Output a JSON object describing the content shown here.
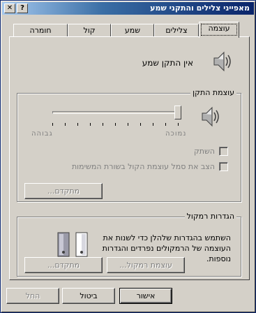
{
  "window": {
    "title": "מאפייני צלילים והתקני שמע",
    "help_button": "?",
    "close_button": "✕"
  },
  "tabs": [
    {
      "label": "עוצמה",
      "active": true
    },
    {
      "label": "צלילים",
      "active": false
    },
    {
      "label": "שמע",
      "active": false
    },
    {
      "label": "קול",
      "active": false
    },
    {
      "label": "חומרה",
      "active": false
    }
  ],
  "device": {
    "label": "אין התקן שמע",
    "icon": "speaker-icon"
  },
  "device_volume": {
    "group_label": "עוצמת התקן",
    "low_label": "נמוכה",
    "high_label": "גבוהה",
    "level": 0.0,
    "mute_label": "השתק",
    "tray_label": "הצב את סמל עוצמת הקול בשורת המשימות",
    "advanced_button": "מתקדם..."
  },
  "speaker_settings": {
    "group_label": "הגדרות רמקול",
    "description": "השתמש בהגדרות שלהלן כדי לשנות את העוצמה של הרמקולים נפרדים והגדרות נוספות.",
    "speaker_volume_button": "עוצמת רמקול...",
    "advanced_button": "מתקדם..."
  },
  "footer": {
    "ok_button": "אישור",
    "cancel_button": "ביטול",
    "apply_button": "החל"
  },
  "colors": {
    "titlebar_dark": "#0a246a",
    "titlebar_light": "#a6caf0",
    "face": "#d4d0c8",
    "disabled_text": "#808080"
  }
}
